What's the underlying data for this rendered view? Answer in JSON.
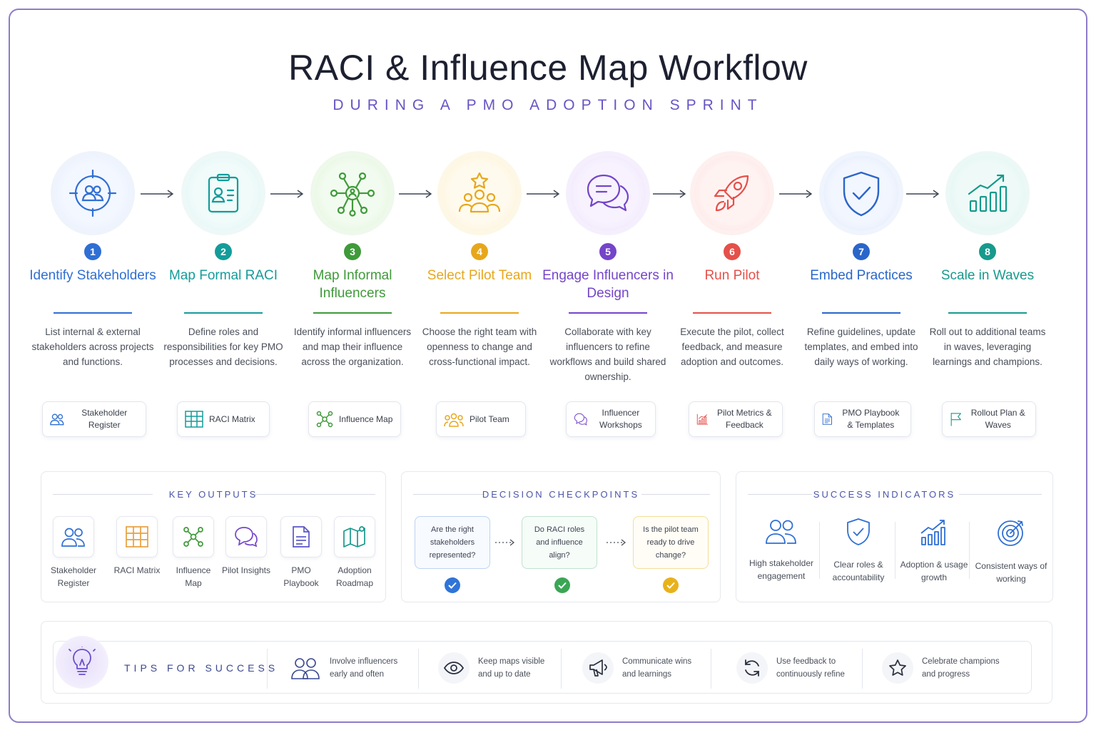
{
  "title": "RACI & Influence Map Workflow",
  "subtitle": "DURING A PMO ADOPTION SPRINT",
  "steps": [
    {
      "num": "1",
      "title": "Identify Stakeholders",
      "desc": "List internal & external stakeholders across projects and functions.",
      "chip": "Stakeholder Register",
      "color": "#2f6fd4",
      "icon": "target-people-icon"
    },
    {
      "num": "2",
      "title": "Map Formal RACI",
      "desc": "Define roles and responsibilities for key PMO processes and decisions.",
      "chip": "RACI Matrix",
      "color": "#149c9a",
      "icon": "clipboard-id-icon"
    },
    {
      "num": "3",
      "title": "Map Informal Influencers",
      "desc": "Identify informal influencers and map their influence across the organization.",
      "chip": "Influence Map",
      "color": "#3f9a3a",
      "icon": "network-icon"
    },
    {
      "num": "4",
      "title": "Select Pilot Team",
      "desc": "Choose the right team with openness to change and cross-functional impact.",
      "chip": "Pilot Team",
      "color": "#e7a71c",
      "icon": "team-star-icon"
    },
    {
      "num": "5",
      "title": "Engage Influencers in Design",
      "desc": "Collaborate with key influencers to refine workflows and build shared ownership.",
      "chip": "Influencer Workshops",
      "color": "#7445c9",
      "icon": "chat-bubbles-icon"
    },
    {
      "num": "6",
      "title": "Run Pilot",
      "desc": "Execute the pilot, collect feedback, and measure adoption and outcomes.",
      "chip": "Pilot Metrics & Feedback",
      "color": "#e5504a",
      "icon": "rocket-icon"
    },
    {
      "num": "7",
      "title": "Embed Practices",
      "desc": "Refine guidelines, update templates, and embed into daily ways of working.",
      "chip": "PMO Playbook & Templates",
      "color": "#2a66c9",
      "icon": "shield-check-icon"
    },
    {
      "num": "8",
      "title": "Scale in Waves",
      "desc": "Roll out to additional teams in waves, leveraging learnings and champions.",
      "chip": "Rollout Plan & Waves",
      "color": "#169a8c",
      "icon": "growth-chart-icon"
    }
  ],
  "key_outputs": {
    "title": "KEY OUTPUTS",
    "items": [
      {
        "label": "Stakeholder Register",
        "color": "#2f6fd4"
      },
      {
        "label": "RACI Matrix",
        "color": "#e7a040"
      },
      {
        "label": "Influence Map",
        "color": "#3f9a3a"
      },
      {
        "label": "Pilot Insights",
        "color": "#7445c9"
      },
      {
        "label": "PMO Playbook",
        "color": "#5a56c6"
      },
      {
        "label": "Adoption Roadmap",
        "color": "#169a8c"
      }
    ]
  },
  "decision_checkpoints": {
    "title": "DECISION CHECKPOINTS",
    "items": [
      {
        "question": "Are the right stakeholders represented?",
        "color": "#2f74d8"
      },
      {
        "question": "Do RACI roles and influence align?",
        "color": "#3aa655"
      },
      {
        "question": "Is the pilot team ready to drive change?",
        "color": "#e8b21c"
      }
    ]
  },
  "success_indicators": {
    "title": "SUCCESS INDICATORS",
    "items": [
      {
        "label": "High stakeholder engagement",
        "color": "#2f6fd4"
      },
      {
        "label": "Clear roles & accountability",
        "color": "#2f6fd4"
      },
      {
        "label": "Adoption & usage growth",
        "color": "#2f6fd4"
      },
      {
        "label": "Consistent ways of working",
        "color": "#2f6fd4"
      }
    ]
  },
  "tips": {
    "title": "TIPS FOR SUCCESS",
    "items": [
      {
        "text": "Involve influencers early and often",
        "icon": "people-icon"
      },
      {
        "text": "Keep maps visible and up to date",
        "icon": "eye-icon"
      },
      {
        "text": "Communicate wins and learnings",
        "icon": "megaphone-icon"
      },
      {
        "text": "Use feedback to continuously refine",
        "icon": "refresh-icon"
      },
      {
        "text": "Celebrate champions and progress",
        "icon": "star-icon"
      }
    ]
  }
}
